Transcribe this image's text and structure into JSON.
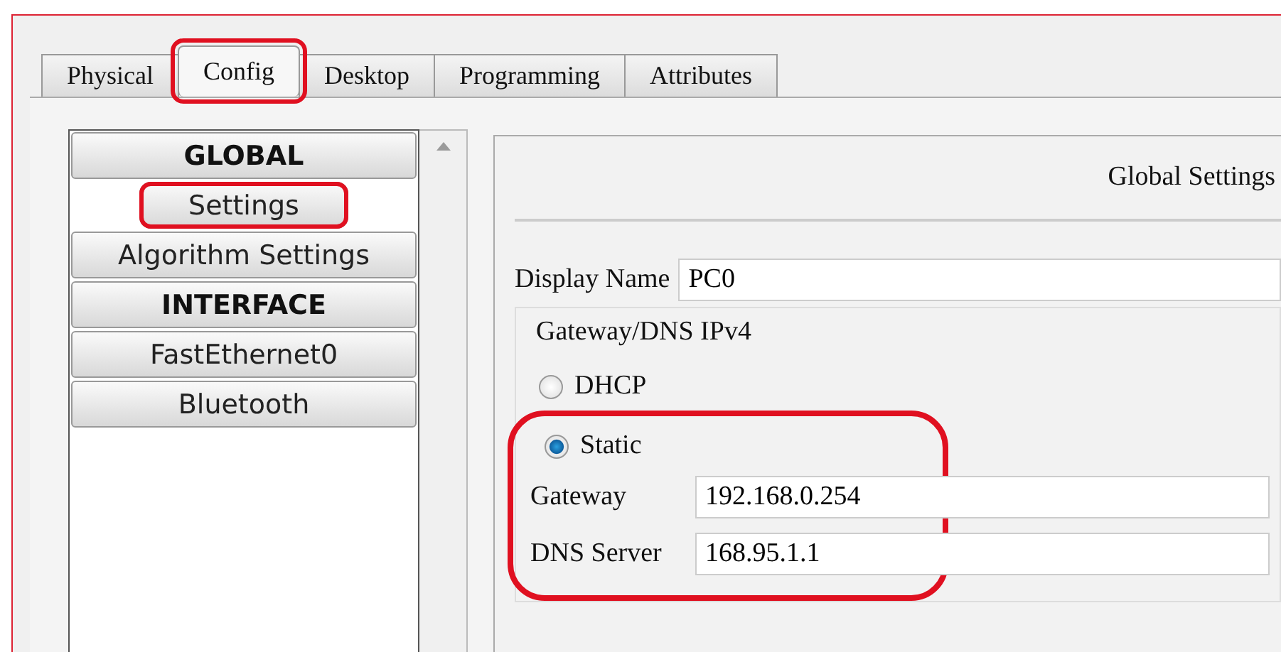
{
  "tabs": [
    {
      "label": "Physical",
      "selected": false,
      "highlighted": false
    },
    {
      "label": "Config",
      "selected": true,
      "highlighted": true
    },
    {
      "label": "Desktop",
      "selected": false,
      "highlighted": false
    },
    {
      "label": "Programming",
      "selected": false,
      "highlighted": false
    },
    {
      "label": "Attributes",
      "selected": false,
      "highlighted": false
    }
  ],
  "sidebar": {
    "items": [
      {
        "label": "GLOBAL",
        "kind": "header",
        "highlighted": false
      },
      {
        "label": "Settings",
        "kind": "item",
        "highlighted": true
      },
      {
        "label": "Algorithm Settings",
        "kind": "item",
        "highlighted": false
      },
      {
        "label": "INTERFACE",
        "kind": "header",
        "highlighted": false
      },
      {
        "label": "FastEthernet0",
        "kind": "item",
        "highlighted": false
      },
      {
        "label": "Bluetooth",
        "kind": "item",
        "highlighted": false
      }
    ]
  },
  "panel": {
    "title": "Global Settings",
    "display_name": {
      "label": "Display Name",
      "value": "PC0"
    },
    "group": {
      "title": "Gateway/DNS IPv4",
      "highlighted": true,
      "modes": [
        {
          "label": "DHCP",
          "selected": false
        },
        {
          "label": "Static",
          "selected": true
        }
      ],
      "fields": [
        {
          "label": "Gateway",
          "value": "192.168.0.254"
        },
        {
          "label": "DNS Server",
          "value": "168.95.1.1"
        }
      ]
    }
  }
}
